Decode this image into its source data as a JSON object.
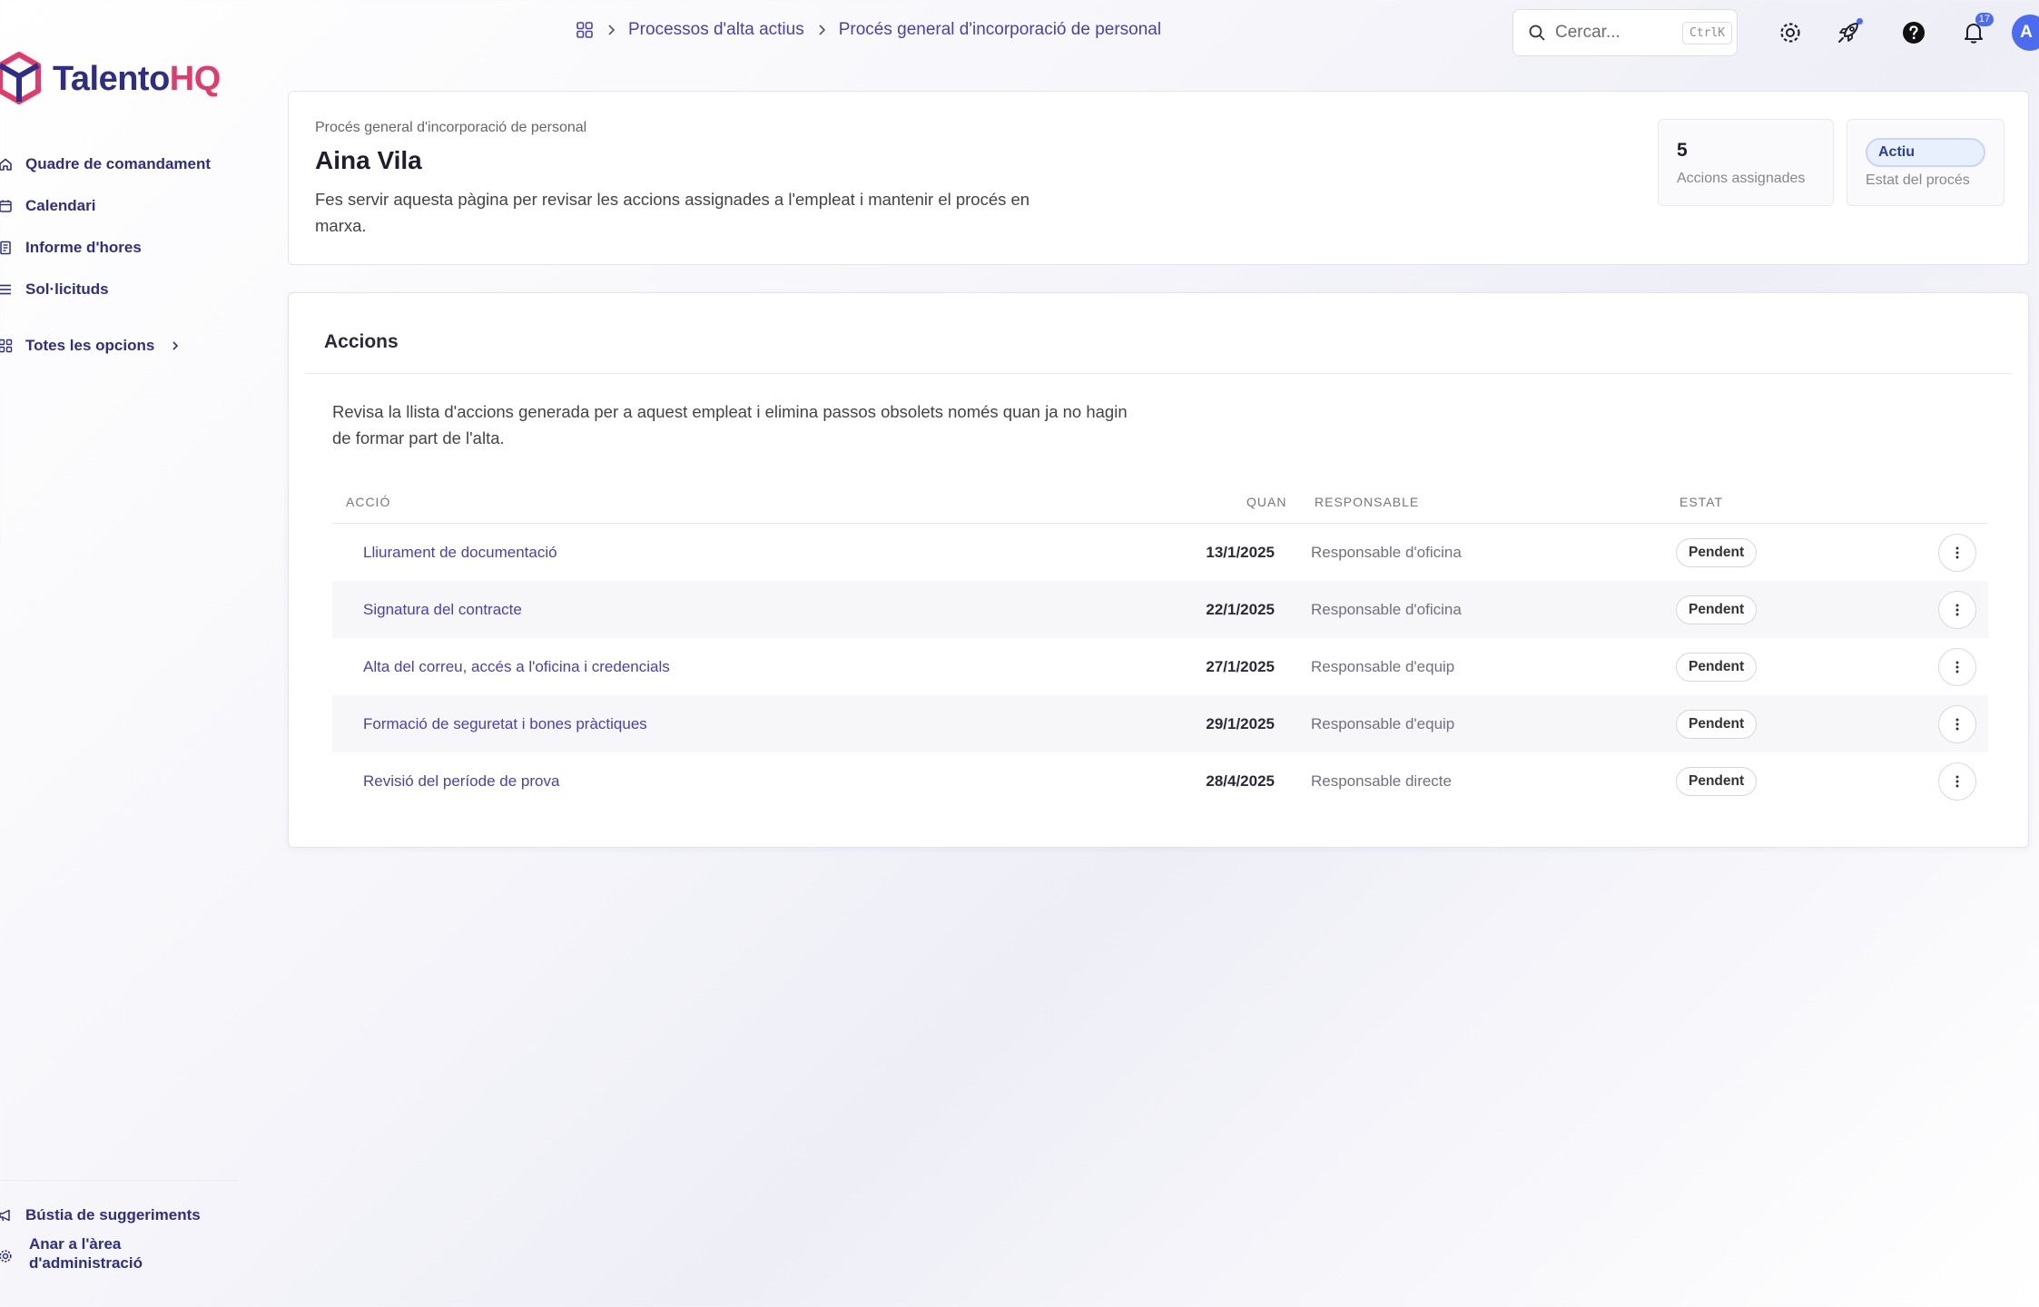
{
  "app": {
    "brand_name": "Talento",
    "brand_suffix": "HQ",
    "brand_colors": {
      "primary": "#2e2e86",
      "accent": "#e23b6b"
    }
  },
  "sidebar": {
    "items": [
      {
        "label": "Quadre de comandament",
        "icon": "home-icon"
      },
      {
        "label": "Calendari",
        "icon": "calendar-icon"
      },
      {
        "label": "Informe d'hores",
        "icon": "report-icon"
      },
      {
        "label": "Sol·licituds",
        "icon": "list-icon"
      }
    ],
    "all_options": {
      "label": "Totes les opcions",
      "icon": "grid-icon"
    },
    "bottom_items": [
      {
        "label": "Bústia de suggeriments",
        "icon": "megaphone-icon"
      },
      {
        "label": "Anar a l'àrea d'administració",
        "icon": "gear-icon"
      }
    ]
  },
  "topbar": {
    "breadcrumb": [
      "Processos d'alta actius",
      "Procés general d'incorporació de personal"
    ],
    "search": {
      "placeholder": "Cercar...",
      "shortcut": "CtrlK"
    },
    "notifications_count": "17",
    "avatar_initial": "A"
  },
  "header": {
    "eyebrow": "Procés general d'incorporació de personal",
    "employee_name": "Aina Vila",
    "description": "Fes servir aquesta pàgina per revisar les accions assignades a l'empleat i mantenir el procés en marxa.",
    "stats": {
      "assigned_count": "5",
      "assigned_label": "Accions assignades",
      "process_status": "Actiu",
      "process_status_label": "Estat del procés"
    }
  },
  "actions": {
    "title": "Accions",
    "description": "Revisa la llista d'accions generada per a aquest empleat i elimina passos obsolets només quan ja no hagin de formar part de l'alta.",
    "columns": {
      "action": "ACCIÓ",
      "when": "QUAN",
      "owner": "RESPONSABLE",
      "status": "ESTAT"
    },
    "rows": [
      {
        "action": "Lliurament de documentació",
        "when": "13/1/2025",
        "owner": "Responsable d'oficina",
        "status": "Pendent"
      },
      {
        "action": "Signatura del contracte",
        "when": "22/1/2025",
        "owner": "Responsable d'oficina",
        "status": "Pendent"
      },
      {
        "action": "Alta del correu, accés a l'oficina i credencials",
        "when": "27/1/2025",
        "owner": "Responsable d'equip",
        "status": "Pendent"
      },
      {
        "action": "Formació de seguretat i bones pràctiques",
        "when": "29/1/2025",
        "owner": "Responsable d'equip",
        "status": "Pendent"
      },
      {
        "action": "Revisió del període de prova",
        "when": "28/4/2025",
        "owner": "Responsable directe",
        "status": "Pendent"
      }
    ]
  }
}
